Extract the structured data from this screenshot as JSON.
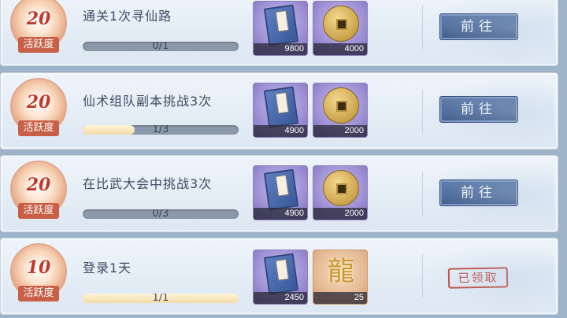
{
  "tasks": [
    {
      "points": "20",
      "points_label": "活跃度",
      "title": "通关1次寻仙路",
      "progress_text": "0/1",
      "progress": 0,
      "reward1_qty": "9800",
      "reward2_qty": "4000",
      "action": "前往"
    },
    {
      "points": "20",
      "points_label": "活跃度",
      "title": "仙术组队副本挑战3次",
      "progress_text": "1/3",
      "progress": 0.333,
      "reward1_qty": "4900",
      "reward2_qty": "2000",
      "action": "前往"
    },
    {
      "points": "20",
      "points_label": "活跃度",
      "title": "在比武大会中挑战3次",
      "progress_text": "0/3",
      "progress": 0,
      "reward1_qty": "4900",
      "reward2_qty": "2000",
      "action": "前往"
    },
    {
      "points": "10",
      "points_label": "活跃度",
      "title": "登录1天",
      "progress_text": "1/1",
      "progress": 1,
      "reward1_qty": "2450",
      "reward2_qty": "25",
      "action": "已领取"
    }
  ],
  "icons": {
    "reward1": "blue-book-icon",
    "reward2_coin": "copper-coin-icon",
    "reward2_dragon": "golden-dragon-icon"
  },
  "colors": {
    "button": "#3c5888",
    "claimed_stamp": "#c0473a",
    "medal_label": "#c85f47"
  }
}
